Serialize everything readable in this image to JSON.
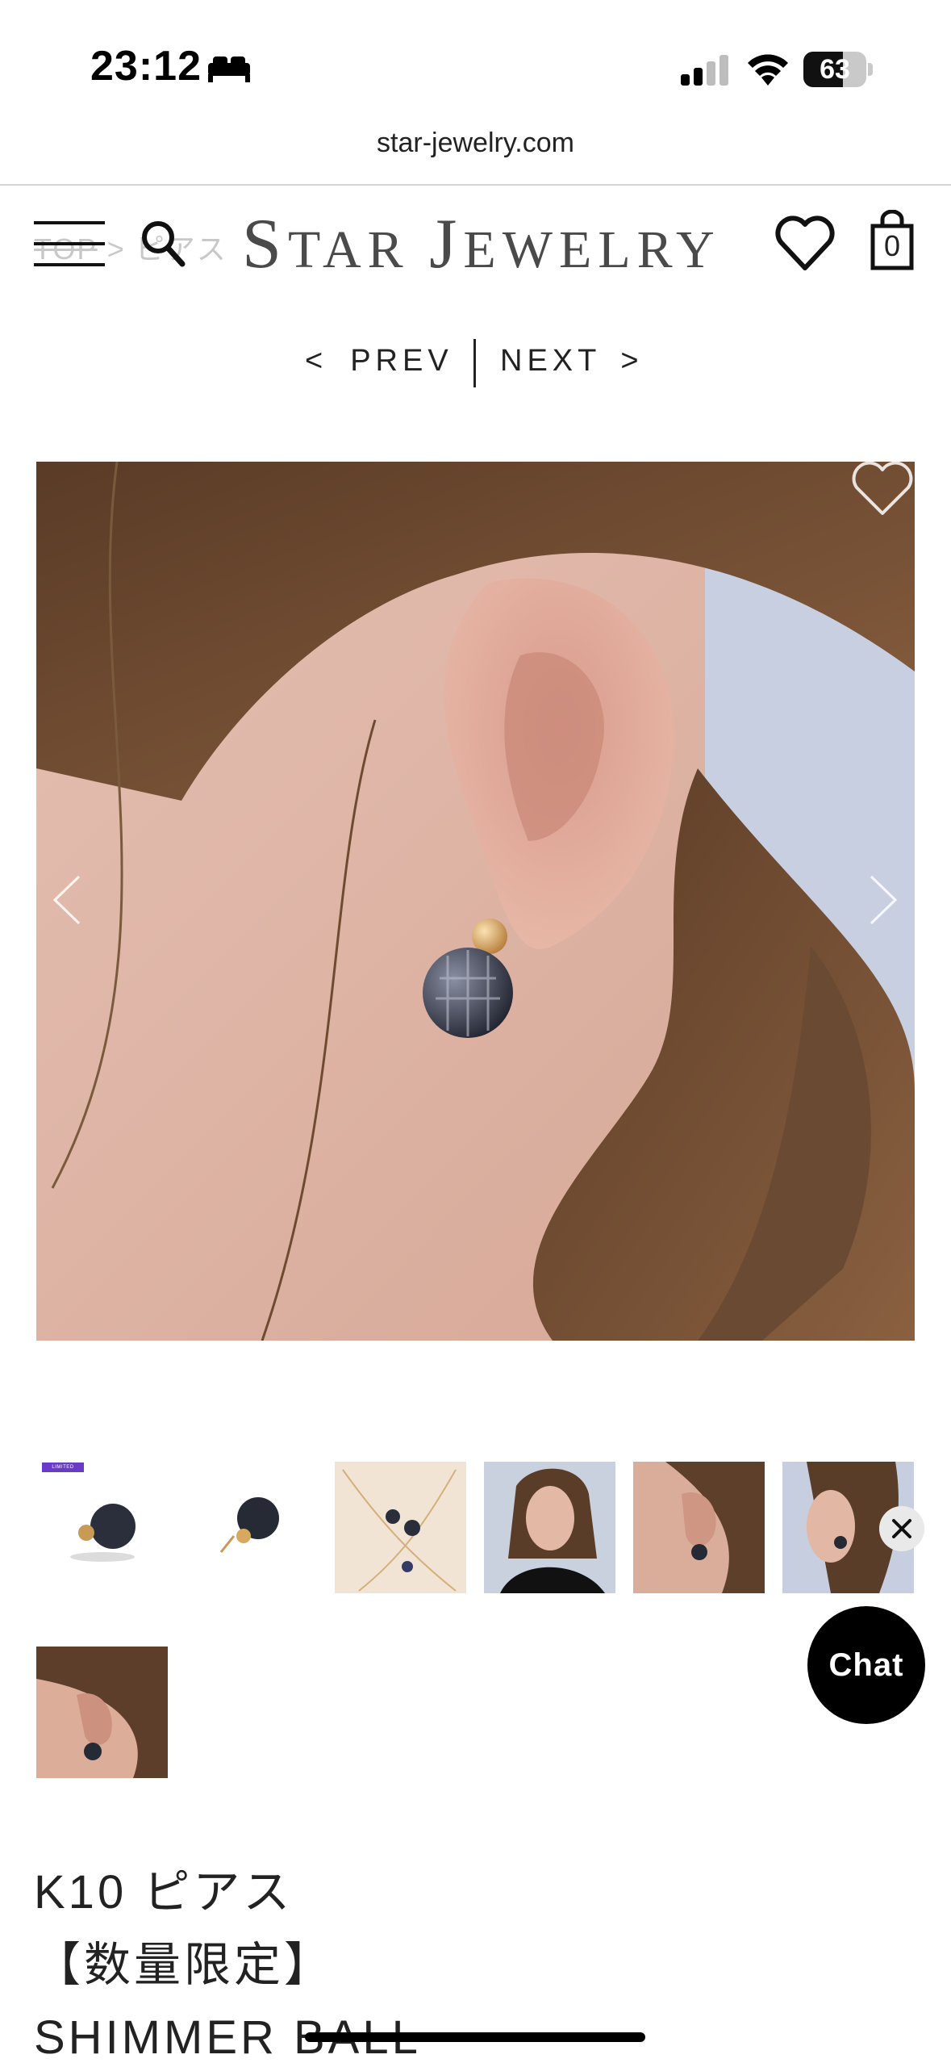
{
  "status_bar": {
    "time": "23:12",
    "battery_level": "63",
    "battery_fraction": 0.63,
    "icons": [
      "bed-icon",
      "cellular-signal-icon",
      "wifi-icon",
      "battery-icon"
    ]
  },
  "browser": {
    "url": "star-jewelry.com"
  },
  "header": {
    "breadcrumb_top": "TOP",
    "breadcrumb_sep": ">",
    "breadcrumb_category": "ピアス",
    "brand_first_initial": "S",
    "brand_first_rest": "TAR",
    "brand_second_initial": "J",
    "brand_second_rest": "EWELRY",
    "cart_count": "0",
    "icons": [
      "menu-icon",
      "search-icon",
      "heart-icon",
      "shopping-bag-icon"
    ]
  },
  "pager": {
    "prev_chevron": "<",
    "prev_label": "PREV",
    "next_label": "NEXT",
    "next_chevron": ">"
  },
  "gallery": {
    "main_image": "ear-with-shimmer-ball-earring",
    "thumbnail_count": 7,
    "badge": "LIMITED EDITION"
  },
  "chat": {
    "label": "Chat"
  },
  "product": {
    "title_line1": "K10 ピアス",
    "title_line2": "【数量限定】",
    "title_line3": "SHIMMER BALL"
  },
  "colors": {
    "text": "#222222",
    "muted": "#c8c8c8",
    "badge": "#6a3bc9",
    "chat_bg": "#000000"
  }
}
